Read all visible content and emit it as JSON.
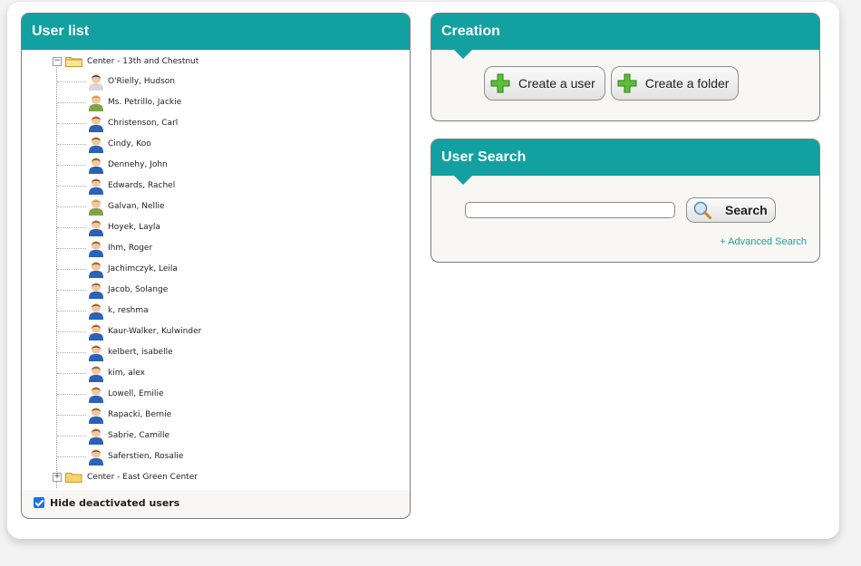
{
  "user_list": {
    "title": "User list",
    "root_folder": "Center - 13th and Chestnut",
    "users": [
      {
        "name": "O'Rielly, Hudson",
        "avatar": "user-male-dark-icon"
      },
      {
        "name": "Ms. Petrillo, Jackie",
        "avatar": "user-female-icon"
      },
      {
        "name": "Christenson, Carl",
        "avatar": "user-icon"
      },
      {
        "name": "Cindy, Koo",
        "avatar": "user-icon"
      },
      {
        "name": "Dennehy, John",
        "avatar": "user-icon"
      },
      {
        "name": "Edwards, Rachel",
        "avatar": "user-icon"
      },
      {
        "name": "Galvan, Nellie",
        "avatar": "user-female-icon"
      },
      {
        "name": "Hoyek, Layla",
        "avatar": "user-icon"
      },
      {
        "name": "Ihm, Roger",
        "avatar": "user-icon"
      },
      {
        "name": "Jachimczyk, Leila",
        "avatar": "user-icon"
      },
      {
        "name": "Jacob, Solange",
        "avatar": "user-icon"
      },
      {
        "name": "k, reshma",
        "avatar": "user-icon"
      },
      {
        "name": "Kaur-Walker, Kulwinder",
        "avatar": "user-icon"
      },
      {
        "name": "kelbert, isabelle",
        "avatar": "user-icon"
      },
      {
        "name": "kim, alex",
        "avatar": "user-icon"
      },
      {
        "name": "Lowell, Emilie",
        "avatar": "user-icon"
      },
      {
        "name": "Rapacki, Bernie",
        "avatar": "user-icon"
      },
      {
        "name": "Sabrie, Camille",
        "avatar": "user-icon"
      },
      {
        "name": "Saferstien, Rosalie",
        "avatar": "user-icon"
      }
    ],
    "next_folder": "Center - East Green Center",
    "hide_deactivated_label": "Hide deactivated users",
    "hide_deactivated_checked": true
  },
  "creation": {
    "title": "Creation",
    "create_user_label": "Create a user",
    "create_folder_label": "Create a folder"
  },
  "user_search": {
    "title": "User Search",
    "query": "",
    "search_label": "Search",
    "advanced_link": "+ Advanced Search"
  },
  "colors": {
    "header": "#12a0a0",
    "link": "#1d9f9f",
    "checkbox": "#1a73e8"
  }
}
